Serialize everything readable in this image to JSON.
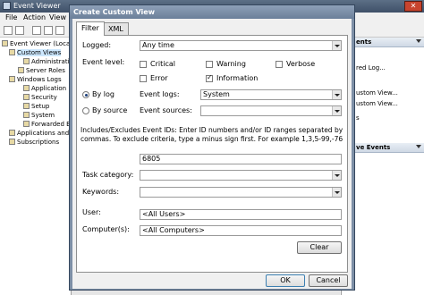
{
  "event_viewer": {
    "title": "Event Viewer",
    "menu": [
      "File",
      "Action",
      "View"
    ],
    "tree": [
      {
        "label": "Event Viewer (Local)"
      },
      {
        "label": "Custom Views"
      },
      {
        "label": "Administrati"
      },
      {
        "label": "Server Roles"
      },
      {
        "label": "Windows Logs"
      },
      {
        "label": "Application"
      },
      {
        "label": "Security"
      },
      {
        "label": "Setup"
      },
      {
        "label": "System"
      },
      {
        "label": "Forwarded E"
      },
      {
        "label": "Applications and"
      },
      {
        "label": "Subscriptions"
      }
    ],
    "actions": {
      "header_top": "ents",
      "items": [
        "red Log...",
        "ustom View...",
        "ustom View...",
        "s"
      ],
      "header_mid": "ve Events"
    }
  },
  "dialog": {
    "title": "Create Custom View",
    "tabs": [
      {
        "label": "Filter"
      },
      {
        "label": "XML"
      }
    ],
    "logged": {
      "label": "Logged:",
      "value": "Any time"
    },
    "event_level": {
      "label": "Event level:",
      "critical": {
        "label": "Critical",
        "checked": false
      },
      "warning": {
        "label": "Warning",
        "checked": false
      },
      "verbose": {
        "label": "Verbose",
        "checked": false
      },
      "error": {
        "label": "Error",
        "checked": false
      },
      "information": {
        "label": "Information",
        "checked": true
      }
    },
    "by_log": {
      "label": "By log",
      "selected": true,
      "event_logs_label": "Event logs:",
      "event_logs_value": "System"
    },
    "by_source": {
      "label": "By source",
      "selected": false,
      "event_sources_label": "Event sources:",
      "event_sources_value": ""
    },
    "description": "Includes/Excludes Event IDs: Enter ID numbers and/or ID ranges separated by commas. To exclude criteria, type a minus sign first. For example 1,3,5-99,-76",
    "event_ids_value": "6805",
    "task_category": {
      "label": "Task category:",
      "value": ""
    },
    "keywords": {
      "label": "Keywords:",
      "value": ""
    },
    "user": {
      "label": "User:",
      "value": "<All Users>"
    },
    "computers": {
      "label": "Computer(s):",
      "value": "<All Computers>"
    },
    "buttons": {
      "clear": "Clear",
      "ok": "OK",
      "cancel": "Cancel"
    }
  }
}
